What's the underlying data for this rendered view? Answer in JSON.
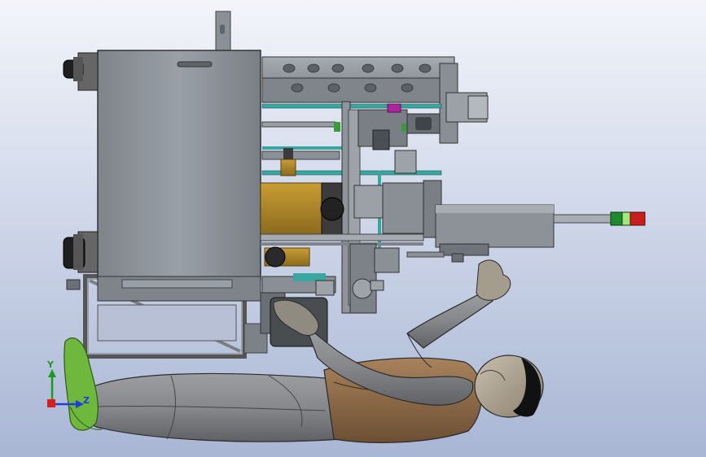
{
  "window": {
    "background_top": "#f3f5fa",
    "background_bottom": "#a9b6d4"
  },
  "triad": {
    "x_label": "",
    "y_label": "Y",
    "z_label": "Z",
    "x_color": "#d81e1e",
    "y_color": "#1e9b1e",
    "z_color": "#1e3cd8"
  },
  "scene": {
    "subject": "machine-assembly-with-human-mannequin",
    "colors": {
      "metal": "#8f949a",
      "metal_dark": "#6f747a",
      "cabinet": "#8d9299",
      "brass": "#b38a2a",
      "teal": "#3aa6a0",
      "magenta": "#b0229e",
      "mannequin_grey": "#8a8c8f",
      "mannequin_brown": "#8a6a4a",
      "mannequin_green": "#6fb83e",
      "light_green": "#3a9b3a",
      "light_red": "#c81e1e"
    }
  }
}
